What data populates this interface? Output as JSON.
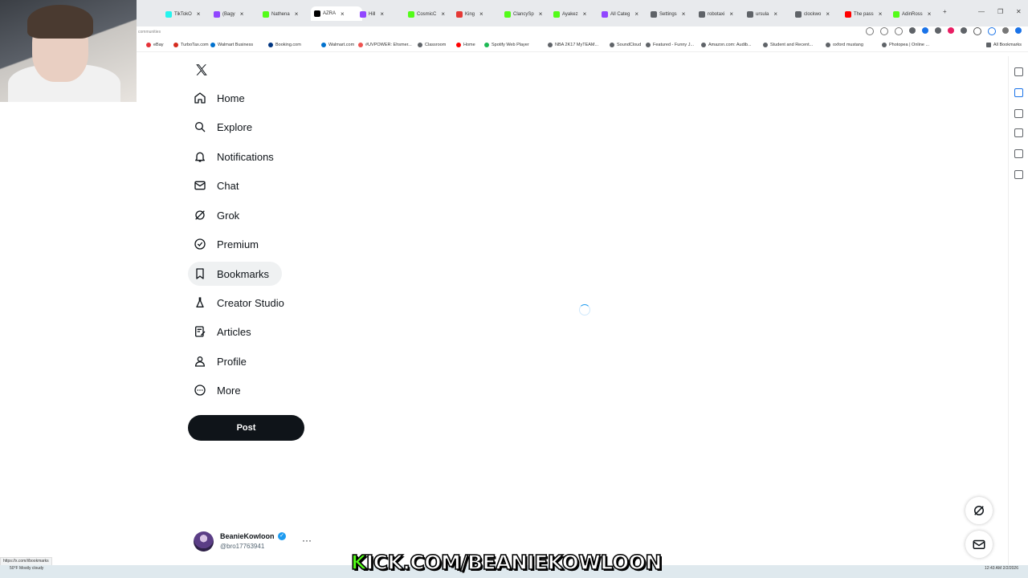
{
  "browser": {
    "tabs": [
      {
        "label": "TikTokO",
        "color": "#25f4ee"
      },
      {
        "label": "(Bagy",
        "color": "#9146ff"
      },
      {
        "label": "Nathena",
        "color": "#53fc18"
      },
      {
        "label": "AZRA",
        "color": "#000000"
      },
      {
        "label": "Hill",
        "color": "#9146ff"
      },
      {
        "label": "CosmicC",
        "color": "#53fc18"
      },
      {
        "label": "King",
        "color": "#e53935"
      },
      {
        "label": "ClancySp",
        "color": "#53fc18"
      },
      {
        "label": "Ayakez",
        "color": "#53fc18"
      },
      {
        "label": "All Categ",
        "color": "#9146ff"
      },
      {
        "label": "Settings",
        "color": "#5f6368"
      },
      {
        "label": "robotaxi",
        "color": "#5f6368"
      },
      {
        "label": "ursula",
        "color": "#5f6368"
      },
      {
        "label": "clockwo",
        "color": "#5f6368"
      },
      {
        "label": "The pass",
        "color": "#ff0000"
      },
      {
        "label": "AdinRoss",
        "color": "#53fc18"
      }
    ],
    "address_hint": "communities",
    "bookmarks": [
      {
        "label": "eBay",
        "color": "#e53238"
      },
      {
        "label": "TurboTax.com",
        "color": "#d52b1e"
      },
      {
        "label": "Walmart Business",
        "color": "#0071ce"
      },
      {
        "label": "Booking.com",
        "color": "#003580"
      },
      {
        "label": "Walmart.com",
        "color": "#0071ce"
      },
      {
        "label": "#UVPOWER: Ehsmer...",
        "color": "#ef5350"
      },
      {
        "label": "Classroom",
        "color": "#5f6368"
      },
      {
        "label": "Home",
        "color": "#ff0000"
      },
      {
        "label": "Spotify Web Player",
        "color": "#1db954"
      },
      {
        "label": "NBA 2K17 MyTEAM...",
        "color": "#5f6368"
      },
      {
        "label": "SoundCloud",
        "color": "#5f6368"
      },
      {
        "label": "Featured - Funny J...",
        "color": "#5f6368"
      },
      {
        "label": "Amazon.com: Audib...",
        "color": "#5f6368"
      },
      {
        "label": "Student and Recent...",
        "color": "#5f6368"
      },
      {
        "label": "oxford mustang",
        "color": "#5f6368"
      },
      {
        "label": "Photopea | Online ...",
        "color": "#5f6368"
      }
    ],
    "all_bookmarks": "All Bookmarks",
    "status_url": "https://x.com/i/bookmarks"
  },
  "sidebar": {
    "items": [
      {
        "label": "Home",
        "icon": "home-icon"
      },
      {
        "label": "Explore",
        "icon": "search-icon"
      },
      {
        "label": "Notifications",
        "icon": "bell-icon"
      },
      {
        "label": "Chat",
        "icon": "mail-icon"
      },
      {
        "label": "Grok",
        "icon": "grok-icon"
      },
      {
        "label": "Premium",
        "icon": "verified-badge-icon"
      },
      {
        "label": "Bookmarks",
        "icon": "bookmark-icon"
      },
      {
        "label": "Creator Studio",
        "icon": "flask-icon"
      },
      {
        "label": "Articles",
        "icon": "article-icon"
      },
      {
        "label": "Profile",
        "icon": "person-icon"
      },
      {
        "label": "More",
        "icon": "more-circle-icon"
      }
    ],
    "post_label": "Post"
  },
  "account": {
    "name": "BeanieKowloon",
    "handle": "@bro17763941"
  },
  "overlay": {
    "kick_prefix": "K",
    "kick_rest": "ICK.COM/BEANIEKOWLOON"
  },
  "taskbar": {
    "weather": "50°F",
    "weather_desc": "Mostly cloudy",
    "time": "12:43 AM",
    "date": "2/2/2026"
  }
}
